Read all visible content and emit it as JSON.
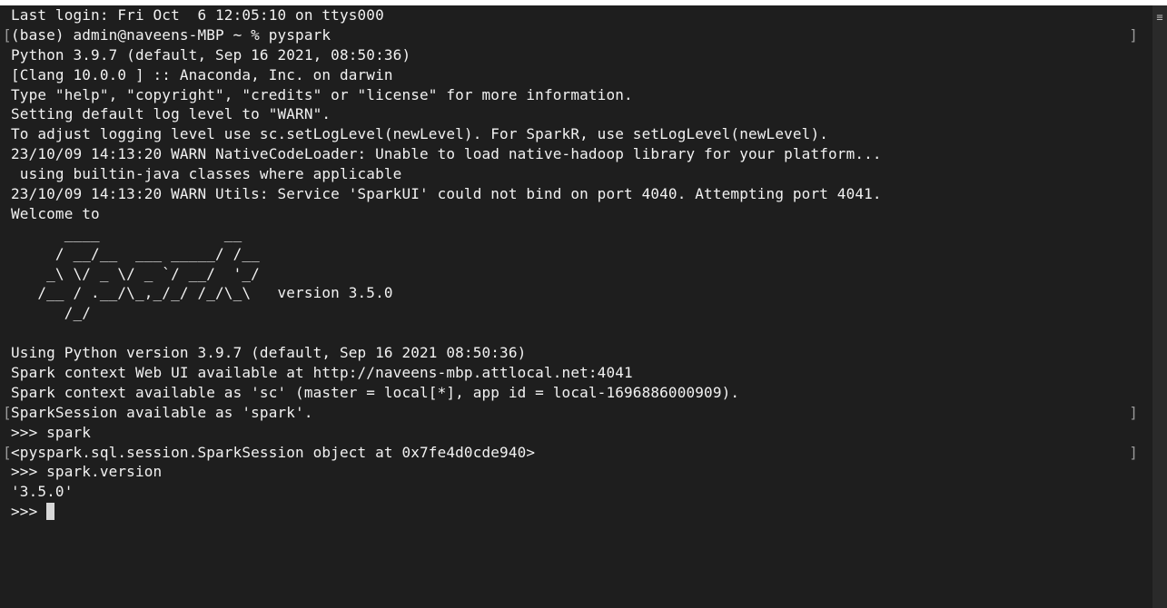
{
  "terminal": {
    "lines": [
      {
        "text": "Last login: Fri Oct  6 12:05:10 on ttys000",
        "mark_left": "",
        "mark_right": ""
      },
      {
        "text": "(base) admin@naveens-MBP ~ % pyspark",
        "mark_left": "[",
        "mark_right": "]"
      },
      {
        "text": "Python 3.9.7 (default, Sep 16 2021, 08:50:36)",
        "mark_left": "",
        "mark_right": ""
      },
      {
        "text": "[Clang 10.0.0 ] :: Anaconda, Inc. on darwin",
        "mark_left": "",
        "mark_right": ""
      },
      {
        "text": "Type \"help\", \"copyright\", \"credits\" or \"license\" for more information.",
        "mark_left": "",
        "mark_right": ""
      },
      {
        "text": "Setting default log level to \"WARN\".",
        "mark_left": "",
        "mark_right": ""
      },
      {
        "text": "To adjust logging level use sc.setLogLevel(newLevel). For SparkR, use setLogLevel(newLevel).",
        "mark_left": "",
        "mark_right": ""
      },
      {
        "text": "23/10/09 14:13:20 WARN NativeCodeLoader: Unable to load native-hadoop library for your platform...",
        "mark_left": "",
        "mark_right": ""
      },
      {
        "text": " using builtin-java classes where applicable",
        "mark_left": "",
        "mark_right": ""
      },
      {
        "text": "23/10/09 14:13:20 WARN Utils: Service 'SparkUI' could not bind on port 4040. Attempting port 4041.",
        "mark_left": "",
        "mark_right": ""
      },
      {
        "text": "Welcome to",
        "mark_left": "",
        "mark_right": ""
      },
      {
        "text": "      ____              __",
        "mark_left": "",
        "mark_right": ""
      },
      {
        "text": "     / __/__  ___ _____/ /__",
        "mark_left": "",
        "mark_right": ""
      },
      {
        "text": "    _\\ \\/ _ \\/ _ `/ __/  '_/",
        "mark_left": "",
        "mark_right": ""
      },
      {
        "text": "   /__ / .__/\\_,_/_/ /_/\\_\\   version 3.5.0",
        "mark_left": "",
        "mark_right": ""
      },
      {
        "text": "      /_/",
        "mark_left": "",
        "mark_right": ""
      },
      {
        "text": "",
        "mark_left": "",
        "mark_right": ""
      },
      {
        "text": "Using Python version 3.9.7 (default, Sep 16 2021 08:50:36)",
        "mark_left": "",
        "mark_right": ""
      },
      {
        "text": "Spark context Web UI available at http://naveens-mbp.attlocal.net:4041",
        "mark_left": "",
        "mark_right": ""
      },
      {
        "text": "Spark context available as 'sc' (master = local[*], app id = local-1696886000909).",
        "mark_left": "",
        "mark_right": ""
      },
      {
        "text": "SparkSession available as 'spark'.",
        "mark_left": "[",
        "mark_right": "]"
      },
      {
        "text": ">>> spark",
        "mark_left": "",
        "mark_right": ""
      },
      {
        "text": "<pyspark.sql.session.SparkSession object at 0x7fe4d0cde940>",
        "mark_left": "[",
        "mark_right": "]"
      },
      {
        "text": ">>> spark.version",
        "mark_left": "",
        "mark_right": ""
      },
      {
        "text": "'3.5.0'",
        "mark_left": "",
        "mark_right": ""
      },
      {
        "text": ">>> ",
        "mark_left": "",
        "mark_right": "",
        "cursor": true
      }
    ]
  },
  "scrollbar": {
    "icon": "hamburger-icon",
    "glyph": "≡"
  },
  "colors": {
    "background": "#1e1e1e",
    "foreground": "#f2f2f2",
    "cursor": "#d8d8d8"
  }
}
